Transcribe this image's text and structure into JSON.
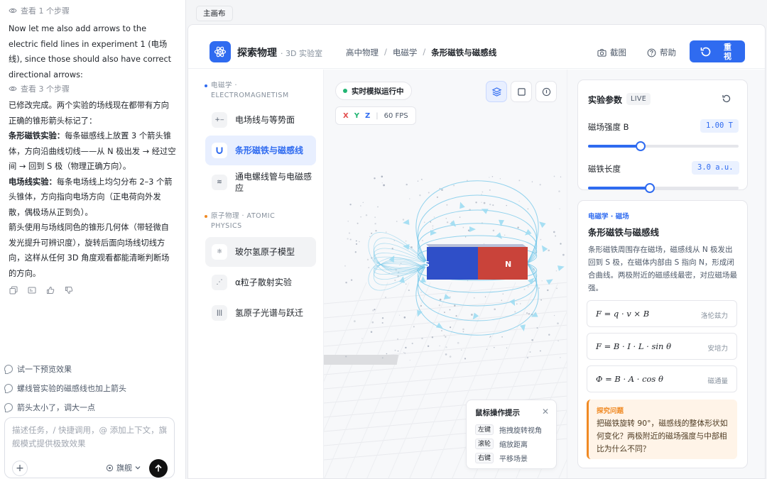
{
  "chat": {
    "step1": "查看 1 个步骤",
    "intro": "Now let me also add arrows to the electric field lines in experiment 1 (电场线), since those should also have correct directional arrows:",
    "step3": "查看 3 个步骤",
    "done": "已修改完成。两个实验的场线现在都带有方向正确的锥形箭头标记了：",
    "magnet_title": "条形磁铁实验：",
    "magnet_text": "每条磁感线上放置 3 个箭头锥体，方向沿曲线切线——从 N 极出发 → 经过空间 → 回到 S 极（物理正确方向）。",
    "efield_title": "电场线实验：",
    "efield_text": "每条电场线上均匀分布 2–3 个箭头锥体，方向指向电场方向（正电荷向外发散，偶极场从正到负）。",
    "style_text": "箭头使用与场线同色的锥形几何体（带轻微自发光提升可辨识度），旋转后面向场线切线方向，这样从任何 3D 角度观看都能清晰判断场的方向。",
    "suggestions": [
      "试一下预览效果",
      "螺线管实验的磁感线也加上箭头",
      "箭头太小了，调大一点"
    ],
    "composer_placeholder": "描述任务，/ 快捷调用，@ 添加上下文，旗舰模式提供极致效果",
    "mode": "旗舰"
  },
  "canvas_tab": "主画布",
  "topbar": {
    "brand": "探索物理",
    "brand_sub": "· 3D 实验室",
    "crumbs": [
      "高中物理",
      "电磁学",
      "条形磁铁与磁感线"
    ],
    "screenshot": "截图",
    "help": "帮助",
    "reset_view": "重视"
  },
  "nav": {
    "group1": "电磁学 · ELECTROMAGNETISM",
    "group2": "原子物理 · ATOMIC PHYSICS",
    "items": [
      {
        "label": "电场线与等势面",
        "icon": "field-lines-icon"
      },
      {
        "label": "条形磁铁与磁感线",
        "icon": "magnet-icon"
      },
      {
        "label": "通电螺线管与电磁感应",
        "icon": "coil-icon"
      },
      {
        "label": "玻尔氢原子模型",
        "icon": "atom-icon"
      },
      {
        "label": "α粒子散射实验",
        "icon": "scatter-icon"
      },
      {
        "label": "氢原子光谱与跃迁",
        "icon": "spectrum-icon"
      }
    ]
  },
  "viewport": {
    "status": "实时模拟运行中",
    "axes": [
      "X",
      "Y",
      "Z"
    ],
    "fps": "60 FPS",
    "magnet_s": "S",
    "magnet_n": "N",
    "colors": {
      "s_pole": "#2f4fc8",
      "n_pole": "#c9433a",
      "field": "#6fc6e8"
    },
    "hint": {
      "title": "鼠标操作提示",
      "rows": [
        {
          "key": "左键",
          "text": "拖拽旋转视角"
        },
        {
          "key": "滚轮",
          "text": "缩放距离"
        },
        {
          "key": "右键",
          "text": "平移场景"
        }
      ]
    }
  },
  "params": {
    "title": "实验参数",
    "live": "LIVE",
    "field_label": "磁场强度 B",
    "field_value": "1.00 T",
    "field_fraction": 0.35,
    "length_label": "磁铁长度",
    "length_value": "3.0 a.u.",
    "length_fraction": 0.41
  },
  "topic": {
    "tag": "电磁学 · 磁场",
    "title": "条形磁铁与磁感线",
    "desc": "条形磁铁周围存在磁场，磁感线从 N 极发出回到 S 极，在磁体内部由 S 指向 N，形成闭合曲线。两极附近的磁感线最密，对应磁场最强。",
    "formulas": [
      {
        "expr": "F = q · v × B",
        "name": "洛伦兹力"
      },
      {
        "expr": "F = B · I · L · sin θ",
        "name": "安培力"
      },
      {
        "expr": "Φ = B · A · cos θ",
        "name": "磁通量"
      }
    ],
    "explore_title": "探究问题",
    "explore_text": "把磁铁旋转 90°，磁感线的整体形状如何变化？两极附近的磁场强度与中部相比为什么不同？"
  }
}
